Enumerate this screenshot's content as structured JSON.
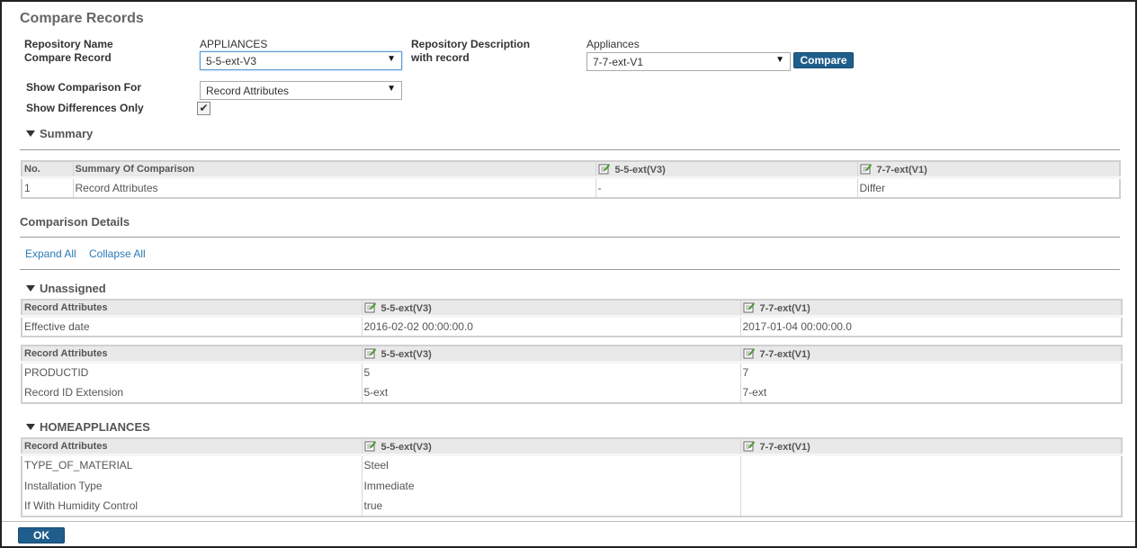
{
  "title": "Compare Records",
  "form": {
    "repository_name_label": "Repository Name",
    "repository_name_value": "APPLIANCES",
    "compare_record_label": "Compare Record",
    "compare_record_value": "5-5-ext-V3",
    "repository_description_label": "Repository Description",
    "repository_description_value": "Appliances",
    "with_record_label": "with record",
    "with_record_value": "7-7-ext-V1",
    "compare_button": "Compare",
    "show_comparison_for_label": "Show Comparison For",
    "show_comparison_for_value": "Record Attributes",
    "show_differences_only_label": "Show Differences Only",
    "show_differences_only_checked": true
  },
  "summary": {
    "heading": "Summary",
    "headers": [
      "No.",
      "Summary Of Comparison",
      "5-5-ext(V3)",
      "7-7-ext(V1)"
    ],
    "rows": [
      [
        "1",
        "Record Attributes",
        "-",
        "Differ"
      ]
    ]
  },
  "details": {
    "heading": "Comparison Details",
    "expand_all": "Expand All",
    "collapse_all": "Collapse All"
  },
  "unassigned": {
    "heading": "Unassigned",
    "table1": {
      "headers": [
        "Record Attributes",
        "5-5-ext(V3)",
        "7-7-ext(V1)"
      ],
      "rows": [
        [
          "Effective date",
          "2016-02-02 00:00:00.0",
          "2017-01-04 00:00:00.0"
        ]
      ]
    },
    "table2": {
      "headers": [
        "Record Attributes",
        "5-5-ext(V3)",
        "7-7-ext(V1)"
      ],
      "rows": [
        [
          "PRODUCTID",
          "5",
          "7"
        ],
        [
          "Record ID Extension",
          "5-ext",
          "7-ext"
        ]
      ]
    }
  },
  "homeappliances": {
    "heading": "HOMEAPPLIANCES",
    "headers": [
      "Record Attributes",
      "5-5-ext(V3)",
      "7-7-ext(V1)"
    ],
    "rows": [
      [
        "TYPE_OF_MATERIAL",
        "Steel",
        ""
      ],
      [
        "Installation Type",
        "Immediate",
        ""
      ],
      [
        "If With Humidity Control",
        "true",
        ""
      ]
    ]
  },
  "footer": {
    "ok_button": "OK"
  },
  "colors": {
    "button": "#1f5e8c",
    "link": "#2a7ab8",
    "header_bg": "#e9e9e9"
  }
}
